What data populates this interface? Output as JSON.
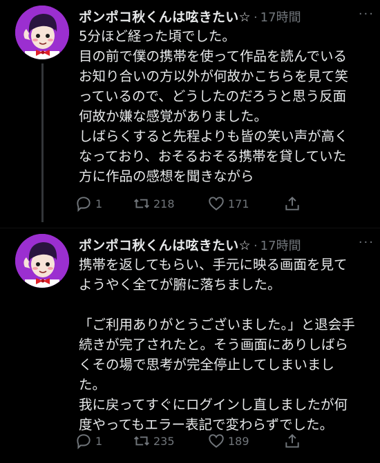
{
  "tweets": [
    {
      "author": "ポンポコ秋くんは呟きたい☆",
      "separator": "·",
      "time": "17時間",
      "text": "5分ほど経った頃でした。\n目の前で僕の携帯を使って作品を読んでいる\nお知り合いの方以外が何故かこちらを見て笑\nっているので、どうしたのだろうと思う反面\n何故か嫌な感覚がありました。\nしばらくすると先程よりも皆の笑い声が高く\nなっており、おそるおそる携帯を貸していた\n方に作品の感想を聞きながら",
      "replies": "1",
      "retweets": "218",
      "likes": "171"
    },
    {
      "author": "ポンポコ秋くんは呟きたい☆",
      "separator": "·",
      "time": "17時間",
      "text": "携帯を返してもらい、手元に映る画面を見て\nようやく全てが腑に落ちました。\n\n「ご利用ありがとうございました。」と退会手\n続きが完了されたと。そう画面にありしばら\nくその場で思考が完全停止してしまいまし\nた。\n我に戻ってすぐにログインし直しましたが何\n度やってもエラー表記で変わらずでした。",
      "replies": "1",
      "retweets": "235",
      "likes": "189"
    }
  ],
  "colors": {
    "background": "#000000",
    "text": "#e7e9ea",
    "muted": "#71767b",
    "avatar_bg": "#9b2fd0"
  },
  "icons": {
    "reply": "reply-icon",
    "retweet": "retweet-icon",
    "like": "heart-icon",
    "share": "share-icon",
    "more": "more-icon"
  }
}
